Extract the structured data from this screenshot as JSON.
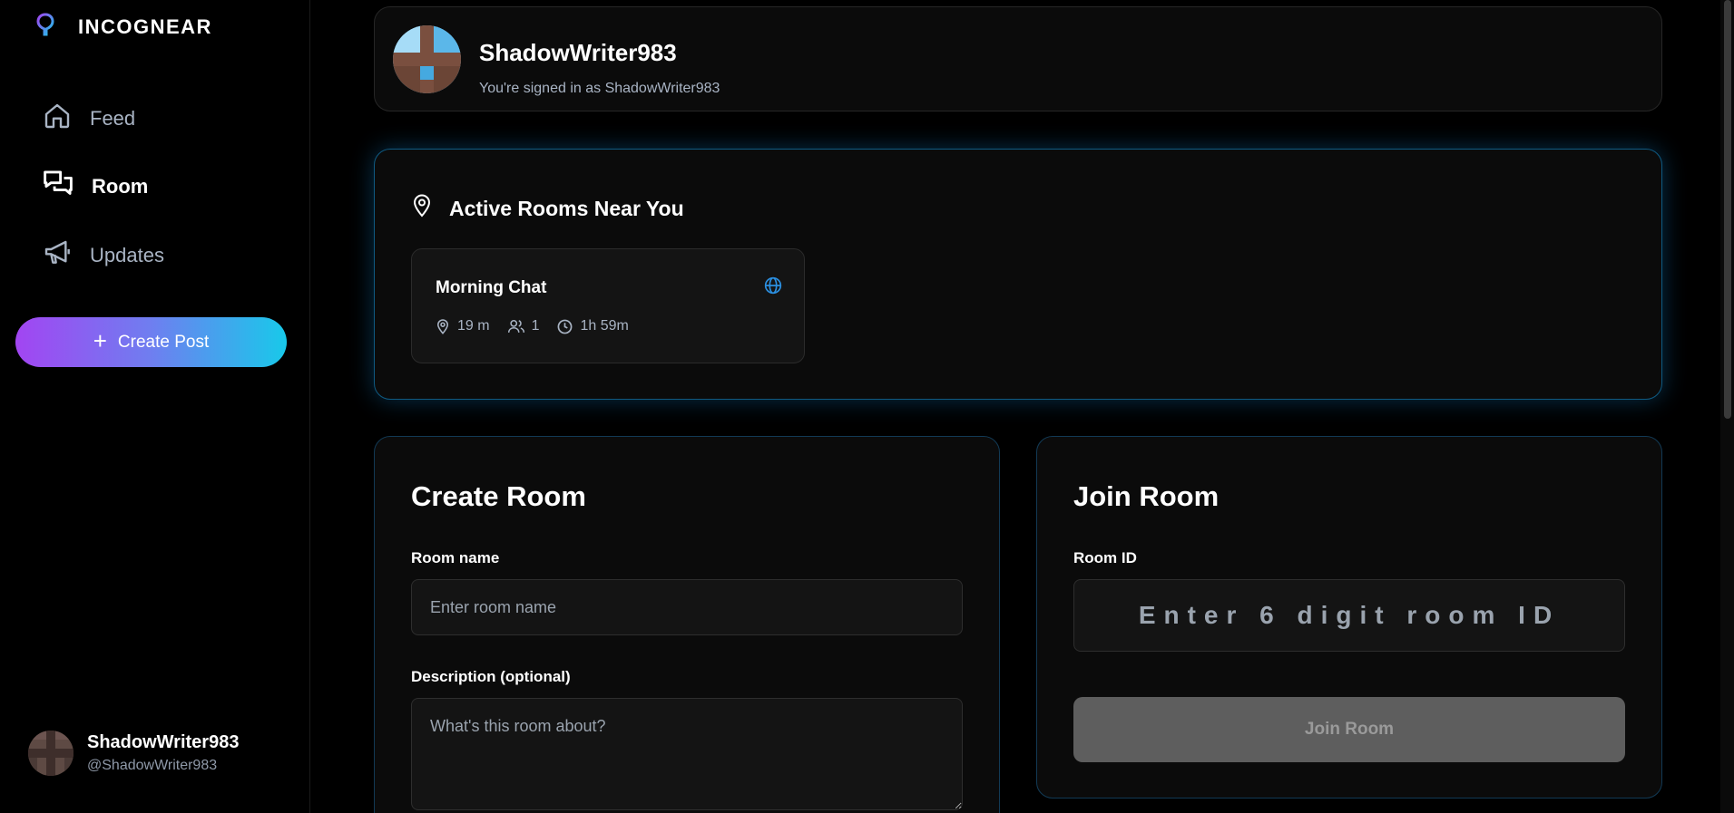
{
  "app": {
    "brand": "INCOGNEAR",
    "accent_gradient": [
      "#a245f2",
      "#18c9ea"
    ]
  },
  "sidebar": {
    "items": [
      {
        "label": "Feed",
        "icon": "home-icon",
        "active": false
      },
      {
        "label": "Room",
        "icon": "chat-bubbles-icon",
        "active": true
      },
      {
        "label": "Updates",
        "icon": "megaphone-icon",
        "active": false
      }
    ],
    "create_post": "Create Post",
    "user": {
      "name": "ShadowWriter983",
      "handle": "@ShadowWriter983"
    }
  },
  "profile": {
    "name": "ShadowWriter983",
    "subtitle": "You're signed in as ShadowWriter983"
  },
  "active_rooms": {
    "title": "Active Rooms Near You",
    "rooms": [
      {
        "name": "Morning Chat",
        "distance": "19 m",
        "members": "1",
        "time_left": "1h 59m",
        "icon": "globe-icon"
      }
    ]
  },
  "create_room": {
    "title": "Create Room",
    "name_label": "Room name",
    "name_placeholder": "Enter room name",
    "desc_label": "Description (optional)",
    "desc_placeholder": "What's this room about?"
  },
  "join_room": {
    "title": "Join Room",
    "id_label": "Room ID",
    "id_placeholder": "Enter 6 digit room ID",
    "button": "Join Room"
  }
}
